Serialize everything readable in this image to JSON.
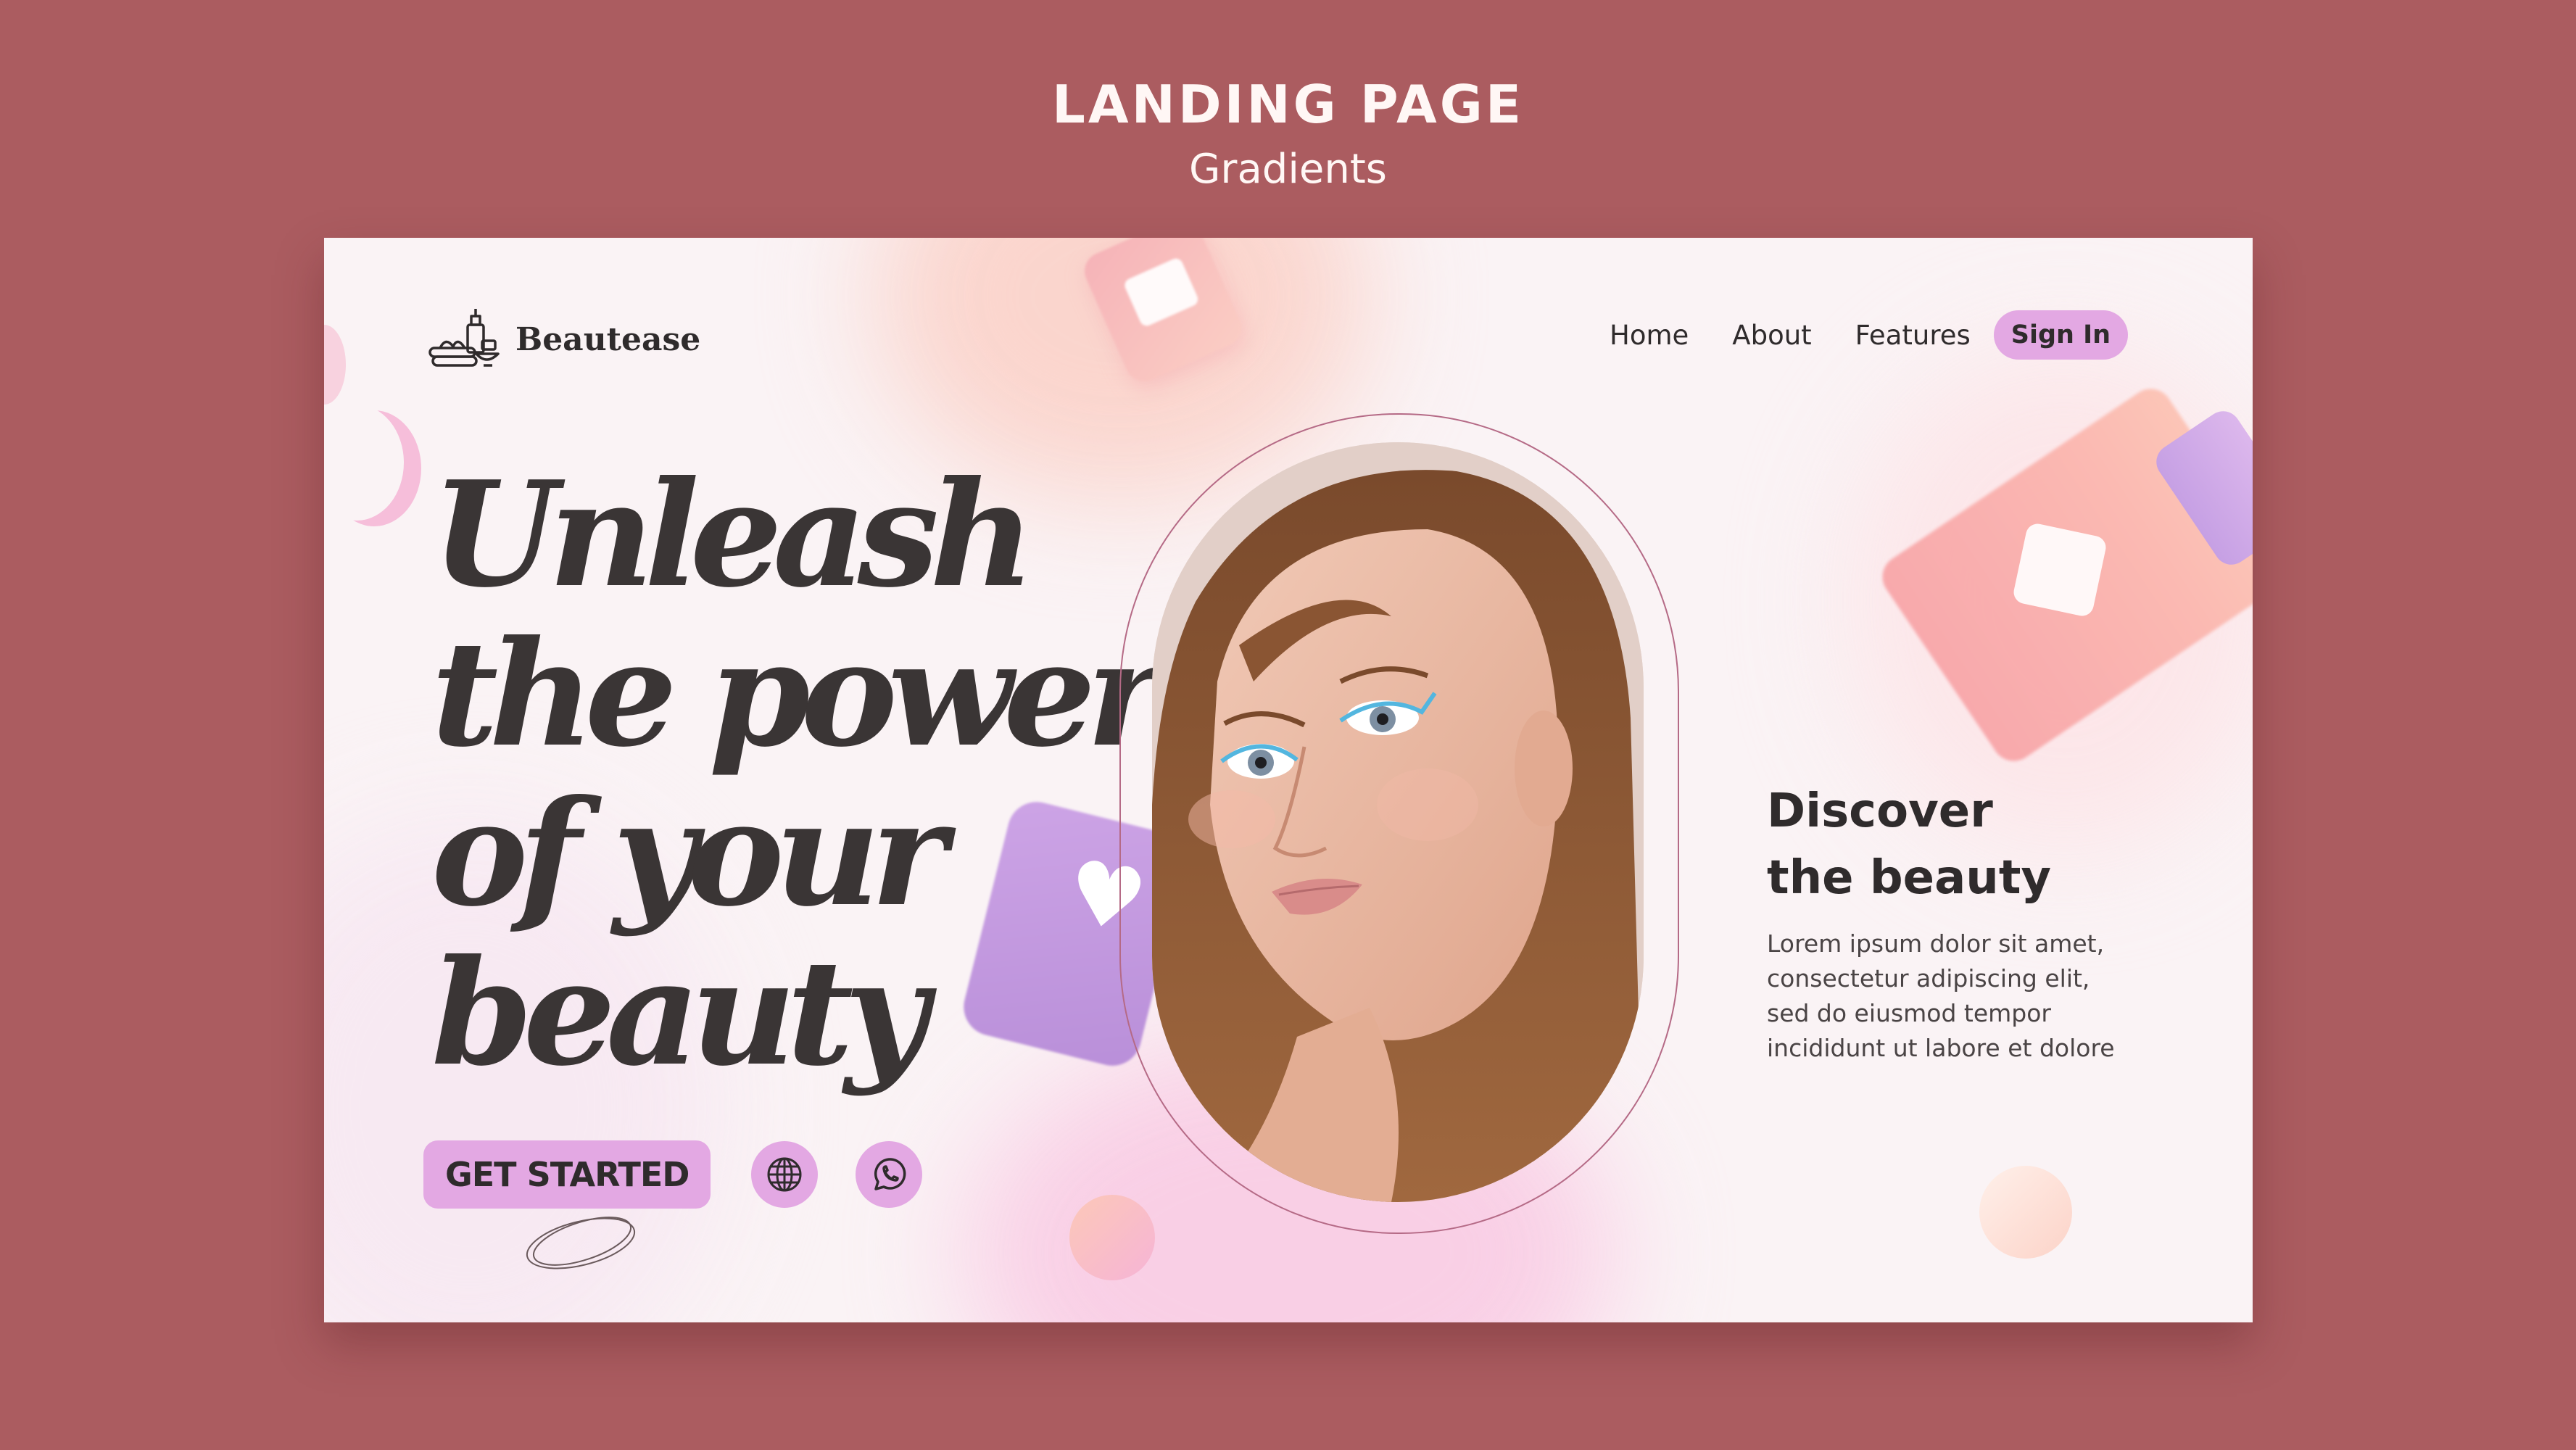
{
  "header": {
    "title": "LANDING PAGE",
    "subtitle": "Gradients"
  },
  "brand": {
    "name": "Beautease",
    "icon": "spa-products-icon"
  },
  "nav": {
    "links": [
      "Home",
      "About",
      "Features"
    ],
    "signin_label": "Sign In"
  },
  "hero": {
    "lines": [
      "Unleash",
      "the power",
      "of your",
      "beauty"
    ]
  },
  "cta": {
    "button_label": "GET STARTED",
    "icons": [
      "globe-icon",
      "whatsapp-icon"
    ]
  },
  "discover": {
    "title_lines": [
      "Discover",
      "the beauty"
    ],
    "body_lines": [
      "Lorem ipsum dolor sit amet,",
      "consectetur adipiscing elit,",
      "sed do eiusmod tempor",
      "incididunt ut labore et dolore"
    ]
  },
  "colors": {
    "background": "#ab5c60",
    "card": "#faf3f5",
    "accent": "#e3a8e3",
    "text": "#2f2b2c"
  }
}
